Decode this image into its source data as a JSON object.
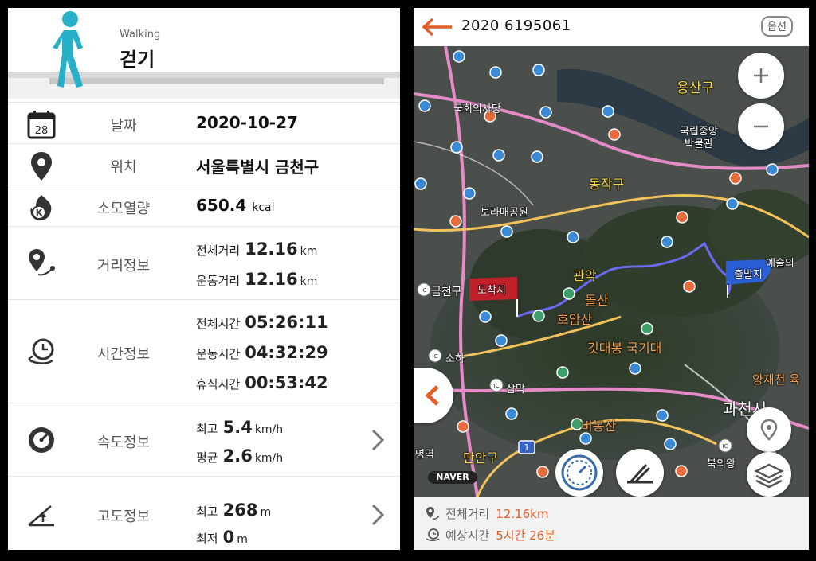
{
  "left": {
    "title_en": "Walking",
    "title_ko": "걷기",
    "date": {
      "label": "날짜",
      "value": "2020-10-27",
      "icon_day": "28"
    },
    "location": {
      "label": "위치",
      "value": "서울특별시 금천구"
    },
    "calories": {
      "label": "소모열량",
      "value": "650.4",
      "unit": "kcal"
    },
    "distance": {
      "label": "거리정보",
      "total_label": "전체거리",
      "total_value": "12.16",
      "total_unit": "km",
      "active_label": "운동거리",
      "active_value": "12.16",
      "active_unit": "km"
    },
    "time": {
      "label": "시간정보",
      "total_label": "전체시간",
      "total_value": "05:26:11",
      "active_label": "운동시간",
      "active_value": "04:32:29",
      "rest_label": "휴식시간",
      "rest_value": "00:53:42"
    },
    "speed": {
      "label": "속도정보",
      "max_label": "최고",
      "max_value": "5.4",
      "max_unit": "km/h",
      "avg_label": "평균",
      "avg_value": "2.6",
      "avg_unit": "km/h"
    },
    "altitude": {
      "label": "고도정보",
      "max_label": "최고",
      "max_value": "268",
      "max_unit": "m",
      "min_label": "최저",
      "min_value": "0",
      "min_unit": "m"
    }
  },
  "right": {
    "title": "2020 6195061",
    "options_label": "옵션",
    "map_labels": {
      "yongsan": "용산구",
      "assembly": "국회의사당",
      "museum1": "국립중앙",
      "museum2": "박물관",
      "dongjak": "동작구",
      "boramae": "보라매공원",
      "gwanak": "관악",
      "arts": "예술의",
      "geumcheon": "금천구",
      "dolsan": "돌산",
      "hoamsan": "호암산",
      "gitdaebong": "깃대봉 국기대",
      "yangjae": "양재천 육",
      "soha": "소하",
      "sammak": "삼막",
      "gwacheon": "과천시",
      "bibongsan": "비봉산",
      "myeongyeok": "명역",
      "manan": "만안구",
      "bukui": "북의왕",
      "naver": "NAVER",
      "start_flag": "출발지",
      "end_flag": "도착지",
      "road_number": "1"
    },
    "bottom": {
      "distance_label": "전체거리",
      "distance_value": "12.16km",
      "time_label": "예상시간",
      "time_value": "5시간 26분"
    },
    "colors": {
      "accent": "#e0602a",
      "route": "#6a6af0",
      "start_flag": "#2a5fd8",
      "end_flag": "#c0202a"
    }
  }
}
